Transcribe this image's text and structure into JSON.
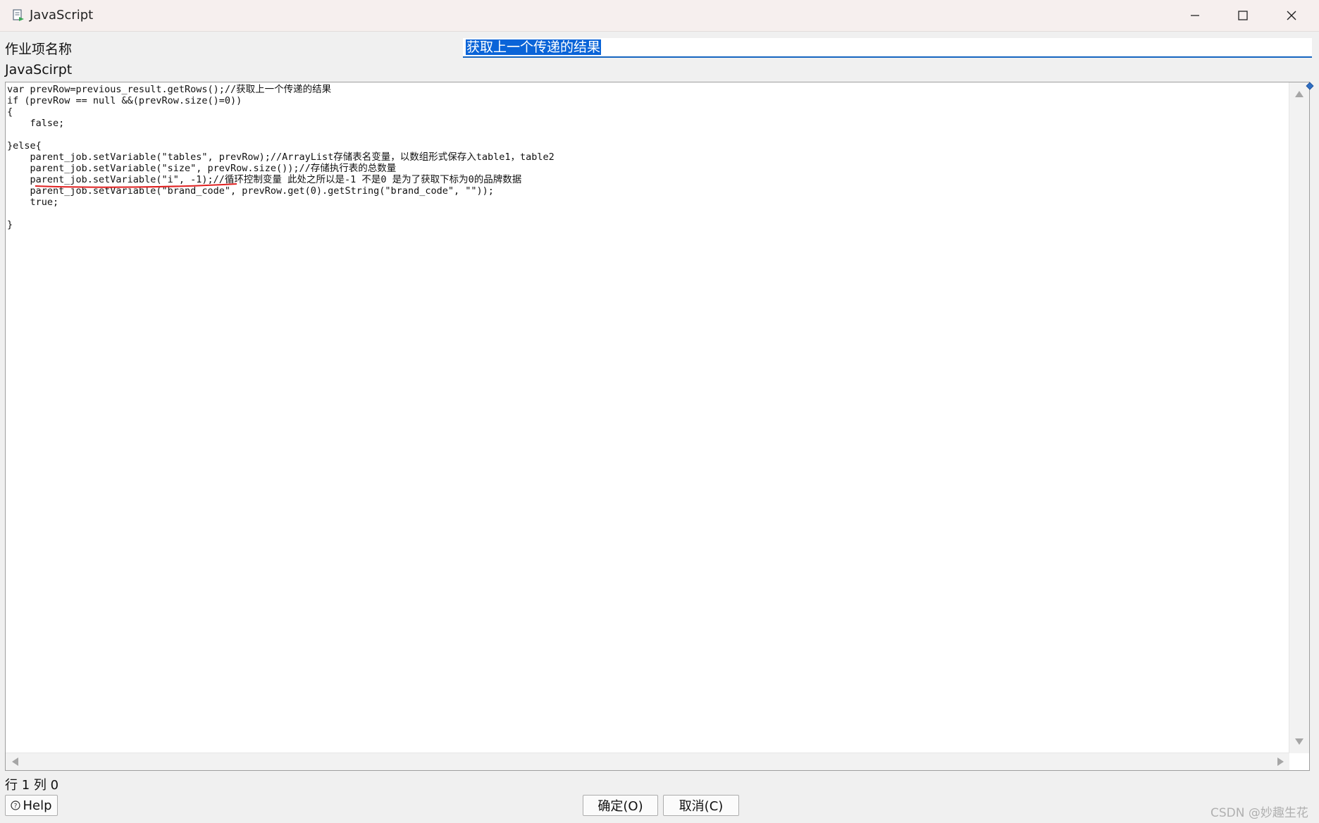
{
  "window": {
    "title": "JavaScript",
    "app_icon": "script-icon",
    "controls": [
      "minimize-icon",
      "maximize-icon",
      "close-icon"
    ]
  },
  "form": {
    "name_label": "作业项名称",
    "name_value": "获取上一个传递的结果",
    "script_label": "JavaScirpt"
  },
  "editor": {
    "lines": [
      "var prevRow=previous_result.getRows();//获取上一个传递的结果",
      "if (prevRow == null &&(prevRow.size()=0))",
      "{",
      "    false;",
      "",
      "}else{",
      "    parent_job.setVariable(\"tables\", prevRow);//ArrayList存储表名变量，以数组形式保存入table1，table2",
      "    parent_job.setVariable(\"size\", prevRow.size());//存储执行表的总数量",
      "    parent_job.setVariable(\"i\", -1);//循环控制变量 此处之所以是-1 不是0 是为了获取下标为0的品牌数据",
      "    parent_job.setVariable(\"brand_code\", prevRow.get(0).getString(\"brand_code\", \"\"));",
      "    true;",
      "",
      "}"
    ],
    "annotation_color": "#e02020"
  },
  "status": {
    "position": "行 1 列 0"
  },
  "buttons": {
    "help": "Help",
    "ok": "确定(O)",
    "cancel": "取消(C)"
  },
  "watermark": "CSDN @妙趣生花",
  "colors": {
    "selection": "#0a64d8",
    "input_underline": "#1565c0"
  }
}
